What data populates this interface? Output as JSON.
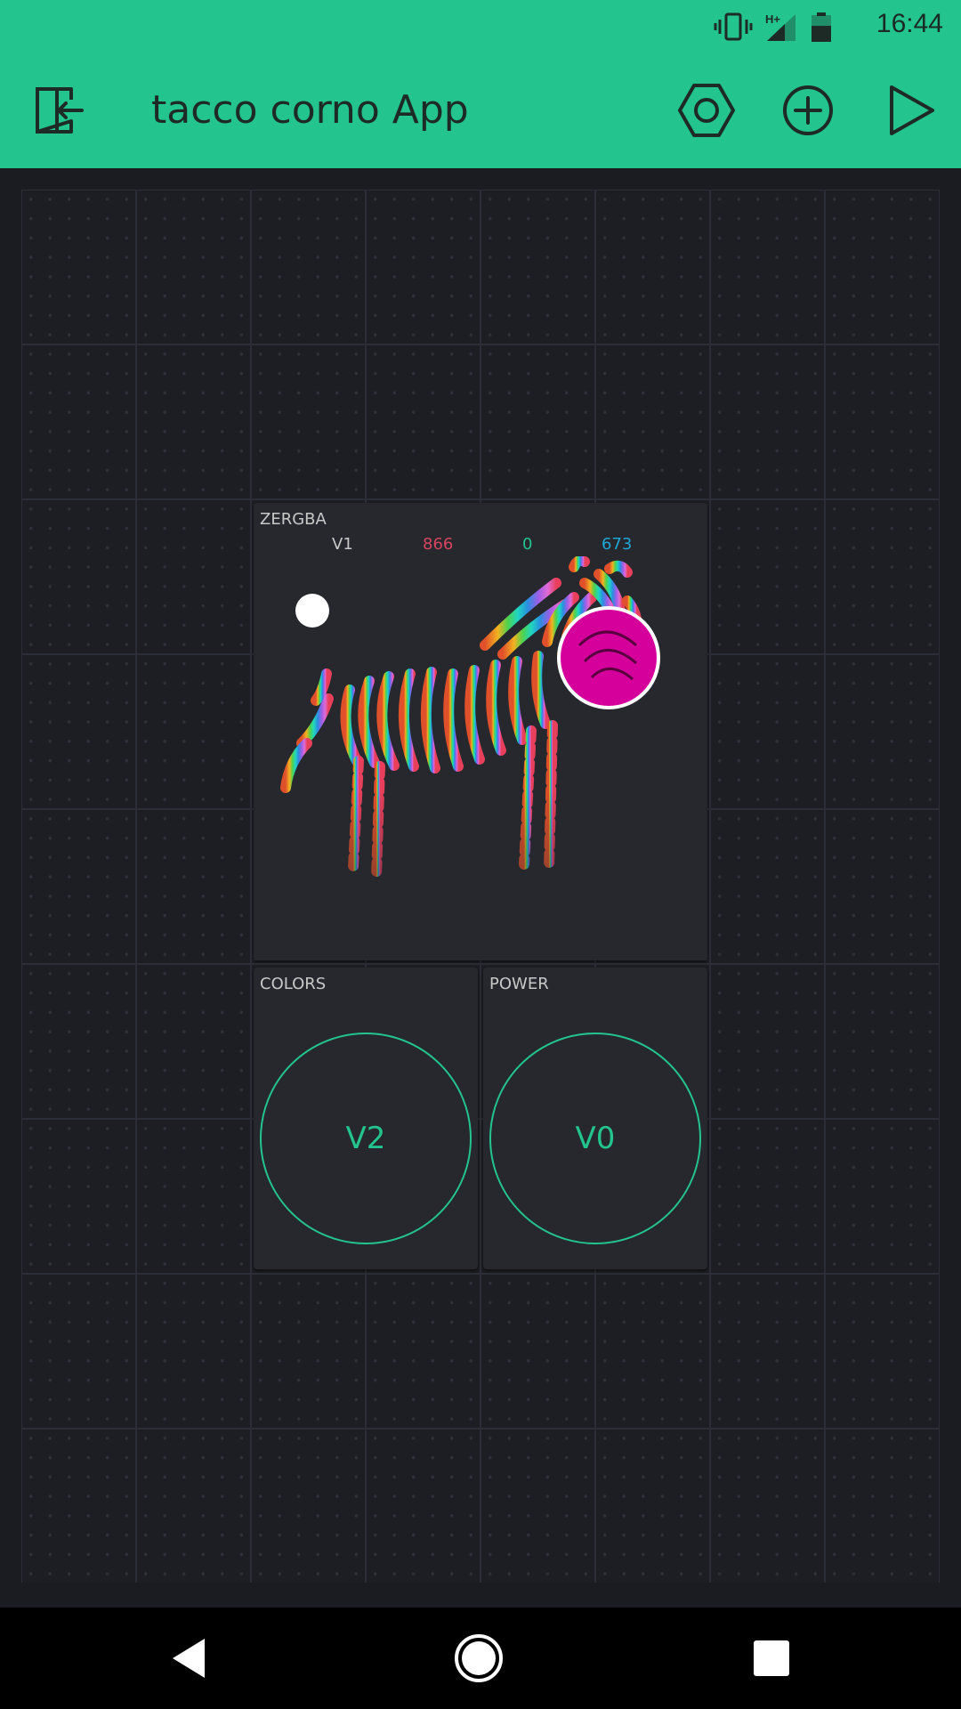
{
  "status_bar": {
    "time": "16:44",
    "network": "H+",
    "icons": [
      "vibrate-icon",
      "signal-icon",
      "battery-icon"
    ],
    "background": "#23c48e"
  },
  "app_bar": {
    "title": "tacco corno App",
    "icons": [
      "exit-icon",
      "settings-hexagon-icon",
      "add-widget-icon",
      "play-icon"
    ]
  },
  "widgets": {
    "zergba": {
      "label": "ZERGBA",
      "pin": "V1",
      "r": "866",
      "g": "0",
      "b": "673",
      "colors": {
        "pin": "#c8c8c8",
        "r": "#d6455f",
        "g": "#23c48e",
        "b": "#1fa7d6",
        "cursor": "#d5009c"
      }
    },
    "colors_button": {
      "label": "COLORS",
      "pin": "V2"
    },
    "power_button": {
      "label": "POWER",
      "pin": "V0"
    }
  },
  "accent": "#23c48e",
  "nav_bar": {
    "icons": [
      "back-icon",
      "home-icon",
      "recents-icon"
    ]
  }
}
